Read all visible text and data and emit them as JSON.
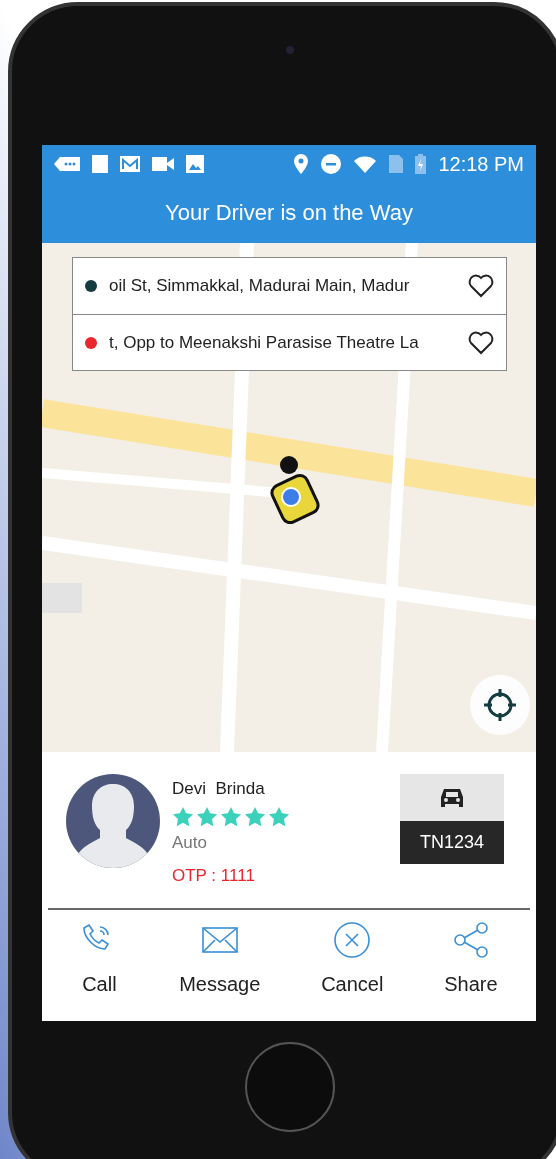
{
  "status_bar": {
    "time": "12:18 PM"
  },
  "header": {
    "title": "Your Driver is on the Way"
  },
  "locations": [
    {
      "text": "oil St, Simmakkal, Madurai Main, Madur",
      "color": "#123c40"
    },
    {
      "text": "t, Opp to Meenakshi Parasise Theatre La",
      "color": "#e8262b"
    }
  ],
  "driver": {
    "name": "Devi  Brinda",
    "stars": 5,
    "vehicle_type": "Auto",
    "otp": "OTP : 1111",
    "plate": "TN1234"
  },
  "actions": [
    {
      "kind": "call",
      "label": "Call"
    },
    {
      "kind": "message",
      "label": "Message"
    },
    {
      "kind": "cancel",
      "label": "Cancel"
    },
    {
      "kind": "share",
      "label": "Share"
    }
  ]
}
